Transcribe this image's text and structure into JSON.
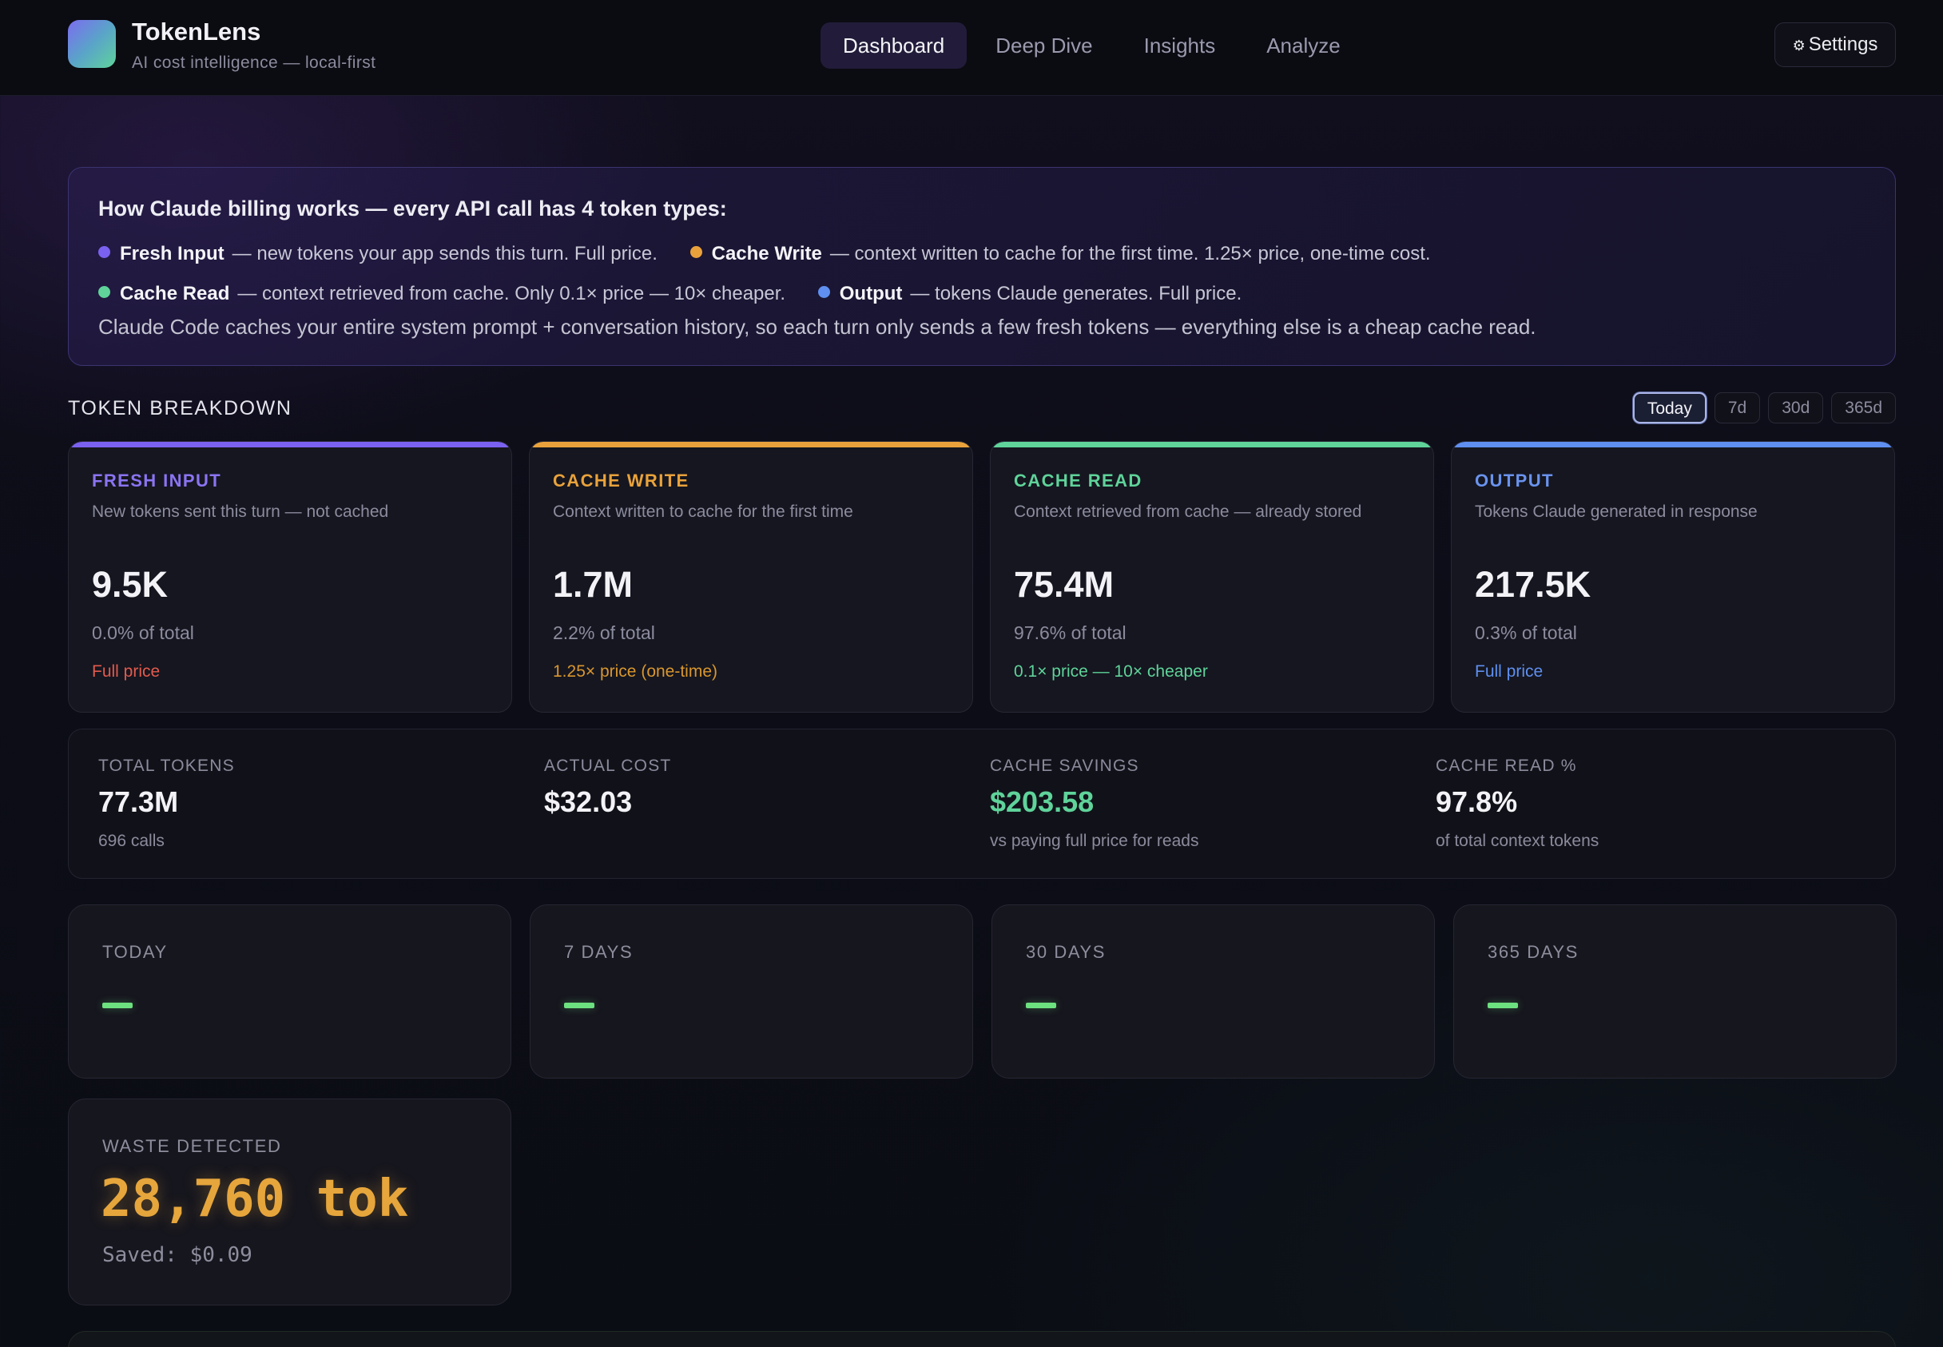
{
  "app": {
    "title": "TokenLens",
    "subtitle": "AI cost intelligence — local-first"
  },
  "nav": {
    "items": [
      {
        "label": "Dashboard",
        "active": true
      },
      {
        "label": "Deep Dive",
        "active": false
      },
      {
        "label": "Insights",
        "active": false
      },
      {
        "label": "Analyze",
        "active": false
      }
    ],
    "settings_icon": "gear-icon",
    "settings_label": "Settings"
  },
  "info": {
    "title": "How Claude billing works — every API call has 4 token types:",
    "types": [
      {
        "name": "Fresh Input",
        "desc": "— new tokens your app sends this turn. Full price.",
        "color": "#7b61f0"
      },
      {
        "name": "Cache Write",
        "desc": "— context written to cache for the first time. 1.25× price, one-time cost.",
        "color": "#e9a23b"
      },
      {
        "name": "Cache Read",
        "desc": "— context retrieved from cache. Only 0.1× price — 10× cheaper.",
        "color": "#5fd39a"
      },
      {
        "name": "Output",
        "desc": "— tokens Claude generates. Full price.",
        "color": "#5f8ff0"
      }
    ],
    "note": "Claude Code caches your entire system prompt + conversation history, so each turn only sends a few fresh tokens — everything else is a cheap cache read."
  },
  "breakdown": {
    "title": "TOKEN BREAKDOWN",
    "ranges": [
      {
        "label": "Today",
        "active": true
      },
      {
        "label": "7d",
        "active": false
      },
      {
        "label": "30d",
        "active": false
      },
      {
        "label": "365d",
        "active": false
      }
    ],
    "cards": [
      {
        "label": "FRESH INPUT",
        "desc": "New tokens sent this turn — not cached",
        "value": "9.5K",
        "pct": "0.0% of total",
        "price": "Full price",
        "accent": "#7b61f0",
        "price_color": "#e25a4e"
      },
      {
        "label": "CACHE WRITE",
        "desc": "Context written to cache for the first time",
        "value": "1.7M",
        "pct": "2.2% of total",
        "price": "1.25× price (one-time)",
        "accent": "#e9a23b",
        "price_color": "#e9a23b"
      },
      {
        "label": "CACHE READ",
        "desc": "Context retrieved from cache — already stored",
        "value": "75.4M",
        "pct": "97.6% of total",
        "price": "0.1× price — 10× cheaper",
        "accent": "#5fd39a",
        "price_color": "#5fd39a"
      },
      {
        "label": "OUTPUT",
        "desc": "Tokens Claude generated in response",
        "value": "217.5K",
        "pct": "0.3% of total",
        "price": "Full price",
        "accent": "#5f8ff0",
        "price_color": "#5f8ff0"
      }
    ]
  },
  "summary": [
    {
      "label": "TOTAL TOKENS",
      "value": "77.3M",
      "sub": "696 calls",
      "color": "#f3f3f7"
    },
    {
      "label": "ACTUAL COST",
      "value": "$32.03",
      "sub": "",
      "color": "#f3f3f7"
    },
    {
      "label": "CACHE SAVINGS",
      "value": "$203.58",
      "sub": "vs paying full price for reads",
      "color": "#5fd39a"
    },
    {
      "label": "CACHE READ %",
      "value": "97.8%",
      "sub": "of total context tokens",
      "color": "#f3f3f7"
    }
  ],
  "periods": [
    {
      "label": "TODAY"
    },
    {
      "label": "7 DAYS"
    },
    {
      "label": "30 DAYS"
    },
    {
      "label": "365 DAYS"
    }
  ],
  "waste": {
    "label": "WASTE DETECTED",
    "value": "28,760 tok",
    "saved": "Saved: $0.09"
  }
}
